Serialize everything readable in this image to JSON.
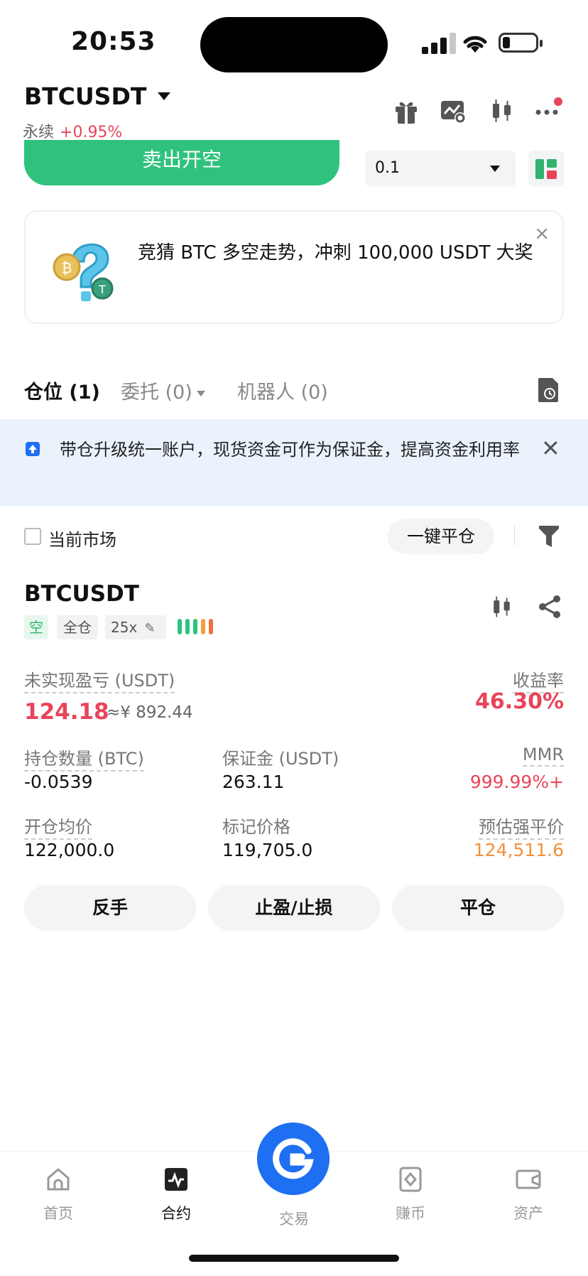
{
  "status_bar": {
    "time": "20:53"
  },
  "header": {
    "symbol": "BTCUSDT",
    "contract_type": "永续",
    "change": "+0.95%",
    "colors": {
      "up": "#e8445a",
      "down": "#2fc27d"
    }
  },
  "order_bar": {
    "sell_button": "卖出开空",
    "quantity": "0.1"
  },
  "promo": {
    "text": "竞猜 BTC 多空走势，冲刺 100,000 USDT 大奖",
    "close": "×"
  },
  "tabs": [
    {
      "label": "仓位 (1)"
    },
    {
      "label": "委托 (0)"
    },
    {
      "label": "机器人 (0)"
    }
  ],
  "banner": {
    "text": "带仓升级统一账户，现货资金可作为保证金，提高资金利用率",
    "close": "✕"
  },
  "filter": {
    "current_market": "当前市场",
    "close_all": "一键平仓"
  },
  "position": {
    "symbol": "BTCUSDT",
    "side": "空",
    "margin_mode": "全仓",
    "leverage": "25x",
    "unrealized_pnl_label": "未实现盈亏 (USDT)",
    "unrealized_pnl": "124.18",
    "unrealized_pnl_cny": "≈¥ 892.44",
    "roi_label": "收益率",
    "roi": "46.30%",
    "size_label": "持仓数量 (BTC)",
    "size": "-0.0539",
    "margin_label": "保证金 (USDT)",
    "margin": "263.11",
    "mmr_label": "MMR",
    "mmr": "999.99%+",
    "entry_label": "开仓均价",
    "entry_price": "122,000.0",
    "mark_label": "标记价格",
    "mark_price": "119,705.0",
    "liq_label": "预估强平价",
    "liq_price": "124,511.6",
    "buttons": {
      "reverse": "反手",
      "tpsl": "止盈/止损",
      "close": "平仓"
    }
  },
  "bottom_nav": [
    {
      "label": "首页"
    },
    {
      "label": "合约"
    },
    {
      "label": "交易"
    },
    {
      "label": "赚币"
    },
    {
      "label": "资产"
    }
  ]
}
